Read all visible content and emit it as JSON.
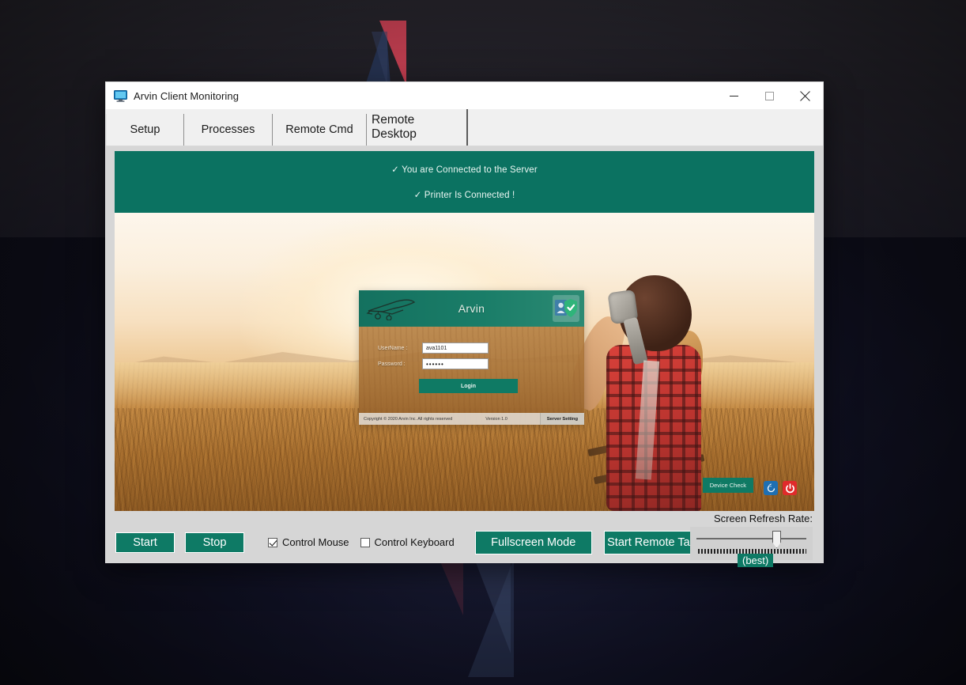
{
  "window": {
    "title": "Arvin Client Monitoring",
    "icon": "monitor-icon",
    "minimize_label": "Minimize",
    "maximize_label": "Maximize",
    "close_label": "Close",
    "accent_color": "#0e7a65",
    "banner_color": "#0b7261"
  },
  "tabs": [
    {
      "label": "Setup",
      "active": false
    },
    {
      "label": "Processes",
      "active": false
    },
    {
      "label": "Remote Cmd",
      "active": false
    },
    {
      "label": "Remote Desktop",
      "active": true
    }
  ],
  "status": {
    "line1": "✓ You are Connected to the Server",
    "line2": "✓ Printer Is Connected !"
  },
  "remote_screen": {
    "description": "Remote desktop view: child in aviator helmet holding toy biplane in sunset field",
    "login_card": {
      "brand": "Arvin",
      "plane_icon": "airplane-icon",
      "badge_icon": "verified-id-badge-icon",
      "username_label": "UserName :",
      "username_value": "ava1101",
      "password_label": "Password  :",
      "password_value": "••••••",
      "login_button": "Login",
      "footer_copyright": "Copyright © 2020 Arvin Inc. All rights reserved",
      "footer_version": "Version 1.0",
      "footer_server_setting": "Server Setting"
    },
    "device_check_button": "Device Check",
    "refresh_icon": "refresh-icon",
    "power_icon": "power-icon"
  },
  "footer": {
    "start_button": "Start",
    "stop_button": "Stop",
    "control_mouse_label": "Control Mouse",
    "control_mouse_checked": true,
    "control_keyboard_label": "Control Keyboard",
    "control_keyboard_checked": false,
    "fullscreen_button": "Fullscreen Mode",
    "task_manager_button": "Start  Remote TaskMa",
    "refresh_rate_label": "Screen Refresh Rate:",
    "refresh_rate_value": "(best)"
  }
}
